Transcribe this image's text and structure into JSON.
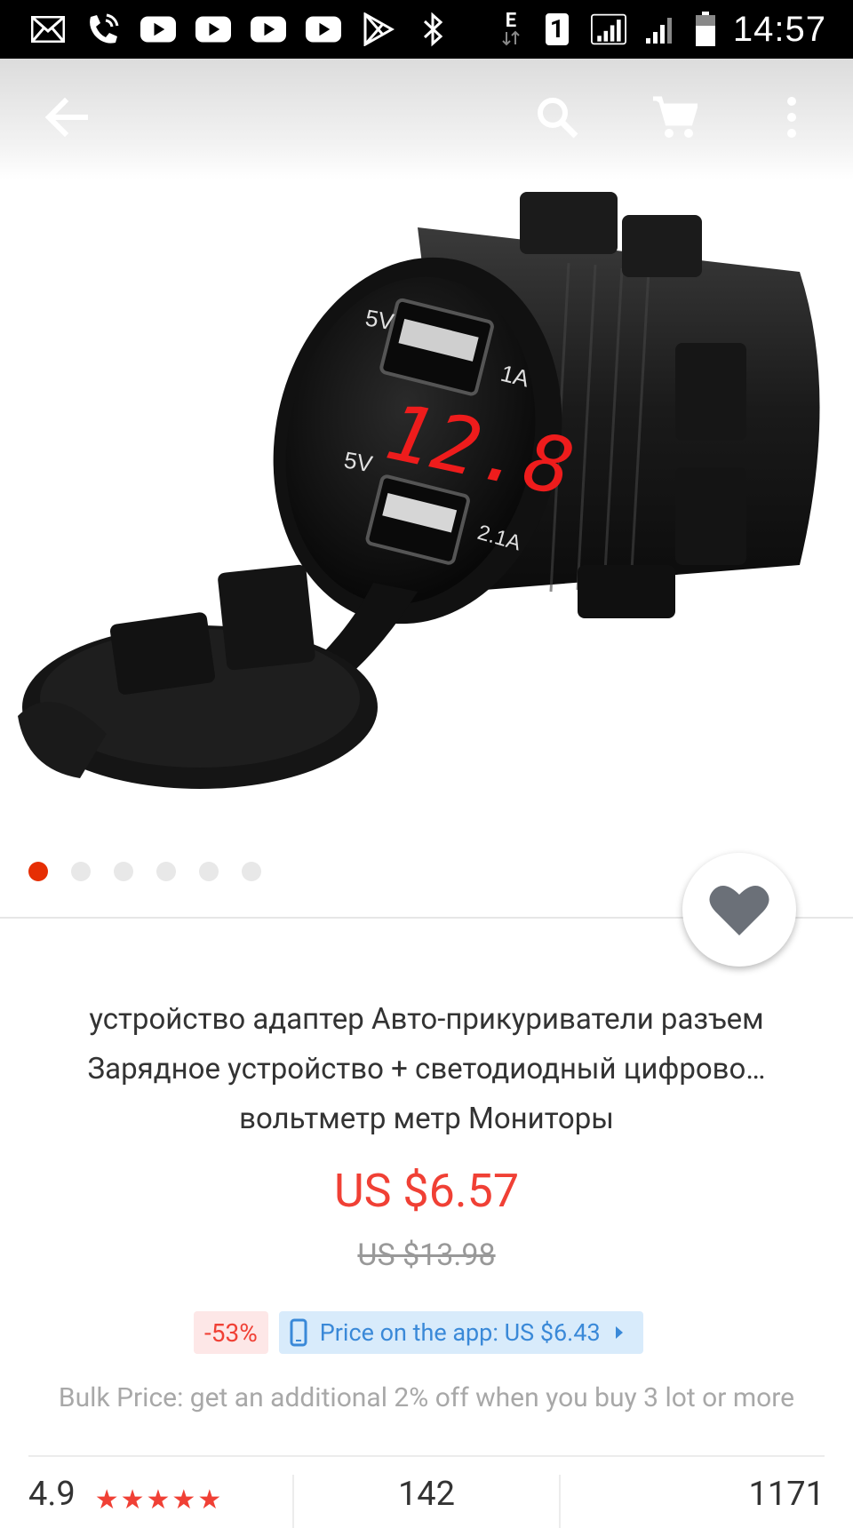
{
  "status_bar": {
    "time": "14:57",
    "network_label": "E",
    "sim_label": "1",
    "icons": [
      "mail-icon",
      "wifi-call-icon",
      "youtube-icon",
      "youtube-icon",
      "youtube-icon",
      "youtube-icon",
      "play-store-icon",
      "bluetooth-icon",
      "data-arrows-icon",
      "sim-icon",
      "signal-icon",
      "signal-icon",
      "battery-icon"
    ]
  },
  "toolbar": {
    "icons": [
      "back-arrow-icon",
      "search-icon",
      "cart-icon",
      "more-vertical-icon"
    ]
  },
  "gallery": {
    "image_count": 6,
    "active_index": 0,
    "image_text": {
      "port_top_voltage": "5V",
      "port_top_current": "1A",
      "display_reading": "12.8",
      "port_bottom_voltage": "5V",
      "port_bottom_current": "2.1A"
    }
  },
  "product": {
    "title_line1": "устройство адаптер Авто-прикуриватели разъем",
    "title_line2": "Зарядное устройство + светодиодный цифрово…",
    "title_line3": "вольтметр метр Мониторы",
    "price": "US $6.57",
    "old_price": "US $13.98",
    "discount": "-53%",
    "app_price": "Price on the app: US $6.43",
    "bulk_note": "Bulk Price: get an additional 2% off when you buy 3 lot or more"
  },
  "stats": {
    "rating": "4.9",
    "stars": "★★★★★",
    "reviews": "142",
    "orders": "1171"
  },
  "colors": {
    "price_red": "#f04035",
    "active_dot": "#e62e04",
    "app_price_blue": "#3a89d8"
  }
}
